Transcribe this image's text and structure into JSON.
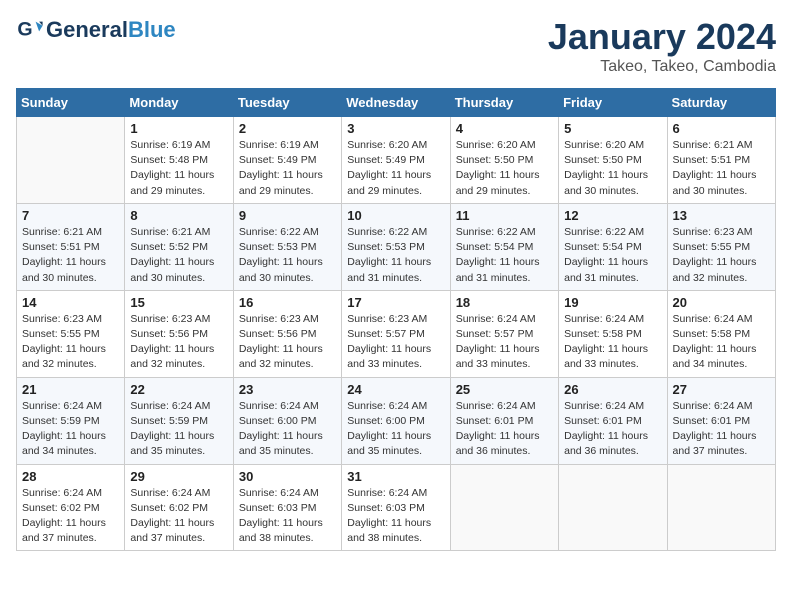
{
  "header": {
    "logo_line1": "General",
    "logo_line2": "Blue",
    "month": "January 2024",
    "location": "Takeo, Takeo, Cambodia"
  },
  "weekdays": [
    "Sunday",
    "Monday",
    "Tuesday",
    "Wednesday",
    "Thursday",
    "Friday",
    "Saturday"
  ],
  "weeks": [
    [
      {
        "num": "",
        "info": ""
      },
      {
        "num": "1",
        "info": "Sunrise: 6:19 AM\nSunset: 5:48 PM\nDaylight: 11 hours\nand 29 minutes."
      },
      {
        "num": "2",
        "info": "Sunrise: 6:19 AM\nSunset: 5:49 PM\nDaylight: 11 hours\nand 29 minutes."
      },
      {
        "num": "3",
        "info": "Sunrise: 6:20 AM\nSunset: 5:49 PM\nDaylight: 11 hours\nand 29 minutes."
      },
      {
        "num": "4",
        "info": "Sunrise: 6:20 AM\nSunset: 5:50 PM\nDaylight: 11 hours\nand 29 minutes."
      },
      {
        "num": "5",
        "info": "Sunrise: 6:20 AM\nSunset: 5:50 PM\nDaylight: 11 hours\nand 30 minutes."
      },
      {
        "num": "6",
        "info": "Sunrise: 6:21 AM\nSunset: 5:51 PM\nDaylight: 11 hours\nand 30 minutes."
      }
    ],
    [
      {
        "num": "7",
        "info": "Sunrise: 6:21 AM\nSunset: 5:51 PM\nDaylight: 11 hours\nand 30 minutes."
      },
      {
        "num": "8",
        "info": "Sunrise: 6:21 AM\nSunset: 5:52 PM\nDaylight: 11 hours\nand 30 minutes."
      },
      {
        "num": "9",
        "info": "Sunrise: 6:22 AM\nSunset: 5:53 PM\nDaylight: 11 hours\nand 30 minutes."
      },
      {
        "num": "10",
        "info": "Sunrise: 6:22 AM\nSunset: 5:53 PM\nDaylight: 11 hours\nand 31 minutes."
      },
      {
        "num": "11",
        "info": "Sunrise: 6:22 AM\nSunset: 5:54 PM\nDaylight: 11 hours\nand 31 minutes."
      },
      {
        "num": "12",
        "info": "Sunrise: 6:22 AM\nSunset: 5:54 PM\nDaylight: 11 hours\nand 31 minutes."
      },
      {
        "num": "13",
        "info": "Sunrise: 6:23 AM\nSunset: 5:55 PM\nDaylight: 11 hours\nand 32 minutes."
      }
    ],
    [
      {
        "num": "14",
        "info": "Sunrise: 6:23 AM\nSunset: 5:55 PM\nDaylight: 11 hours\nand 32 minutes."
      },
      {
        "num": "15",
        "info": "Sunrise: 6:23 AM\nSunset: 5:56 PM\nDaylight: 11 hours\nand 32 minutes."
      },
      {
        "num": "16",
        "info": "Sunrise: 6:23 AM\nSunset: 5:56 PM\nDaylight: 11 hours\nand 32 minutes."
      },
      {
        "num": "17",
        "info": "Sunrise: 6:23 AM\nSunset: 5:57 PM\nDaylight: 11 hours\nand 33 minutes."
      },
      {
        "num": "18",
        "info": "Sunrise: 6:24 AM\nSunset: 5:57 PM\nDaylight: 11 hours\nand 33 minutes."
      },
      {
        "num": "19",
        "info": "Sunrise: 6:24 AM\nSunset: 5:58 PM\nDaylight: 11 hours\nand 33 minutes."
      },
      {
        "num": "20",
        "info": "Sunrise: 6:24 AM\nSunset: 5:58 PM\nDaylight: 11 hours\nand 34 minutes."
      }
    ],
    [
      {
        "num": "21",
        "info": "Sunrise: 6:24 AM\nSunset: 5:59 PM\nDaylight: 11 hours\nand 34 minutes."
      },
      {
        "num": "22",
        "info": "Sunrise: 6:24 AM\nSunset: 5:59 PM\nDaylight: 11 hours\nand 35 minutes."
      },
      {
        "num": "23",
        "info": "Sunrise: 6:24 AM\nSunset: 6:00 PM\nDaylight: 11 hours\nand 35 minutes."
      },
      {
        "num": "24",
        "info": "Sunrise: 6:24 AM\nSunset: 6:00 PM\nDaylight: 11 hours\nand 35 minutes."
      },
      {
        "num": "25",
        "info": "Sunrise: 6:24 AM\nSunset: 6:01 PM\nDaylight: 11 hours\nand 36 minutes."
      },
      {
        "num": "26",
        "info": "Sunrise: 6:24 AM\nSunset: 6:01 PM\nDaylight: 11 hours\nand 36 minutes."
      },
      {
        "num": "27",
        "info": "Sunrise: 6:24 AM\nSunset: 6:01 PM\nDaylight: 11 hours\nand 37 minutes."
      }
    ],
    [
      {
        "num": "28",
        "info": "Sunrise: 6:24 AM\nSunset: 6:02 PM\nDaylight: 11 hours\nand 37 minutes."
      },
      {
        "num": "29",
        "info": "Sunrise: 6:24 AM\nSunset: 6:02 PM\nDaylight: 11 hours\nand 37 minutes."
      },
      {
        "num": "30",
        "info": "Sunrise: 6:24 AM\nSunset: 6:03 PM\nDaylight: 11 hours\nand 38 minutes."
      },
      {
        "num": "31",
        "info": "Sunrise: 6:24 AM\nSunset: 6:03 PM\nDaylight: 11 hours\nand 38 minutes."
      },
      {
        "num": "",
        "info": ""
      },
      {
        "num": "",
        "info": ""
      },
      {
        "num": "",
        "info": ""
      }
    ]
  ]
}
